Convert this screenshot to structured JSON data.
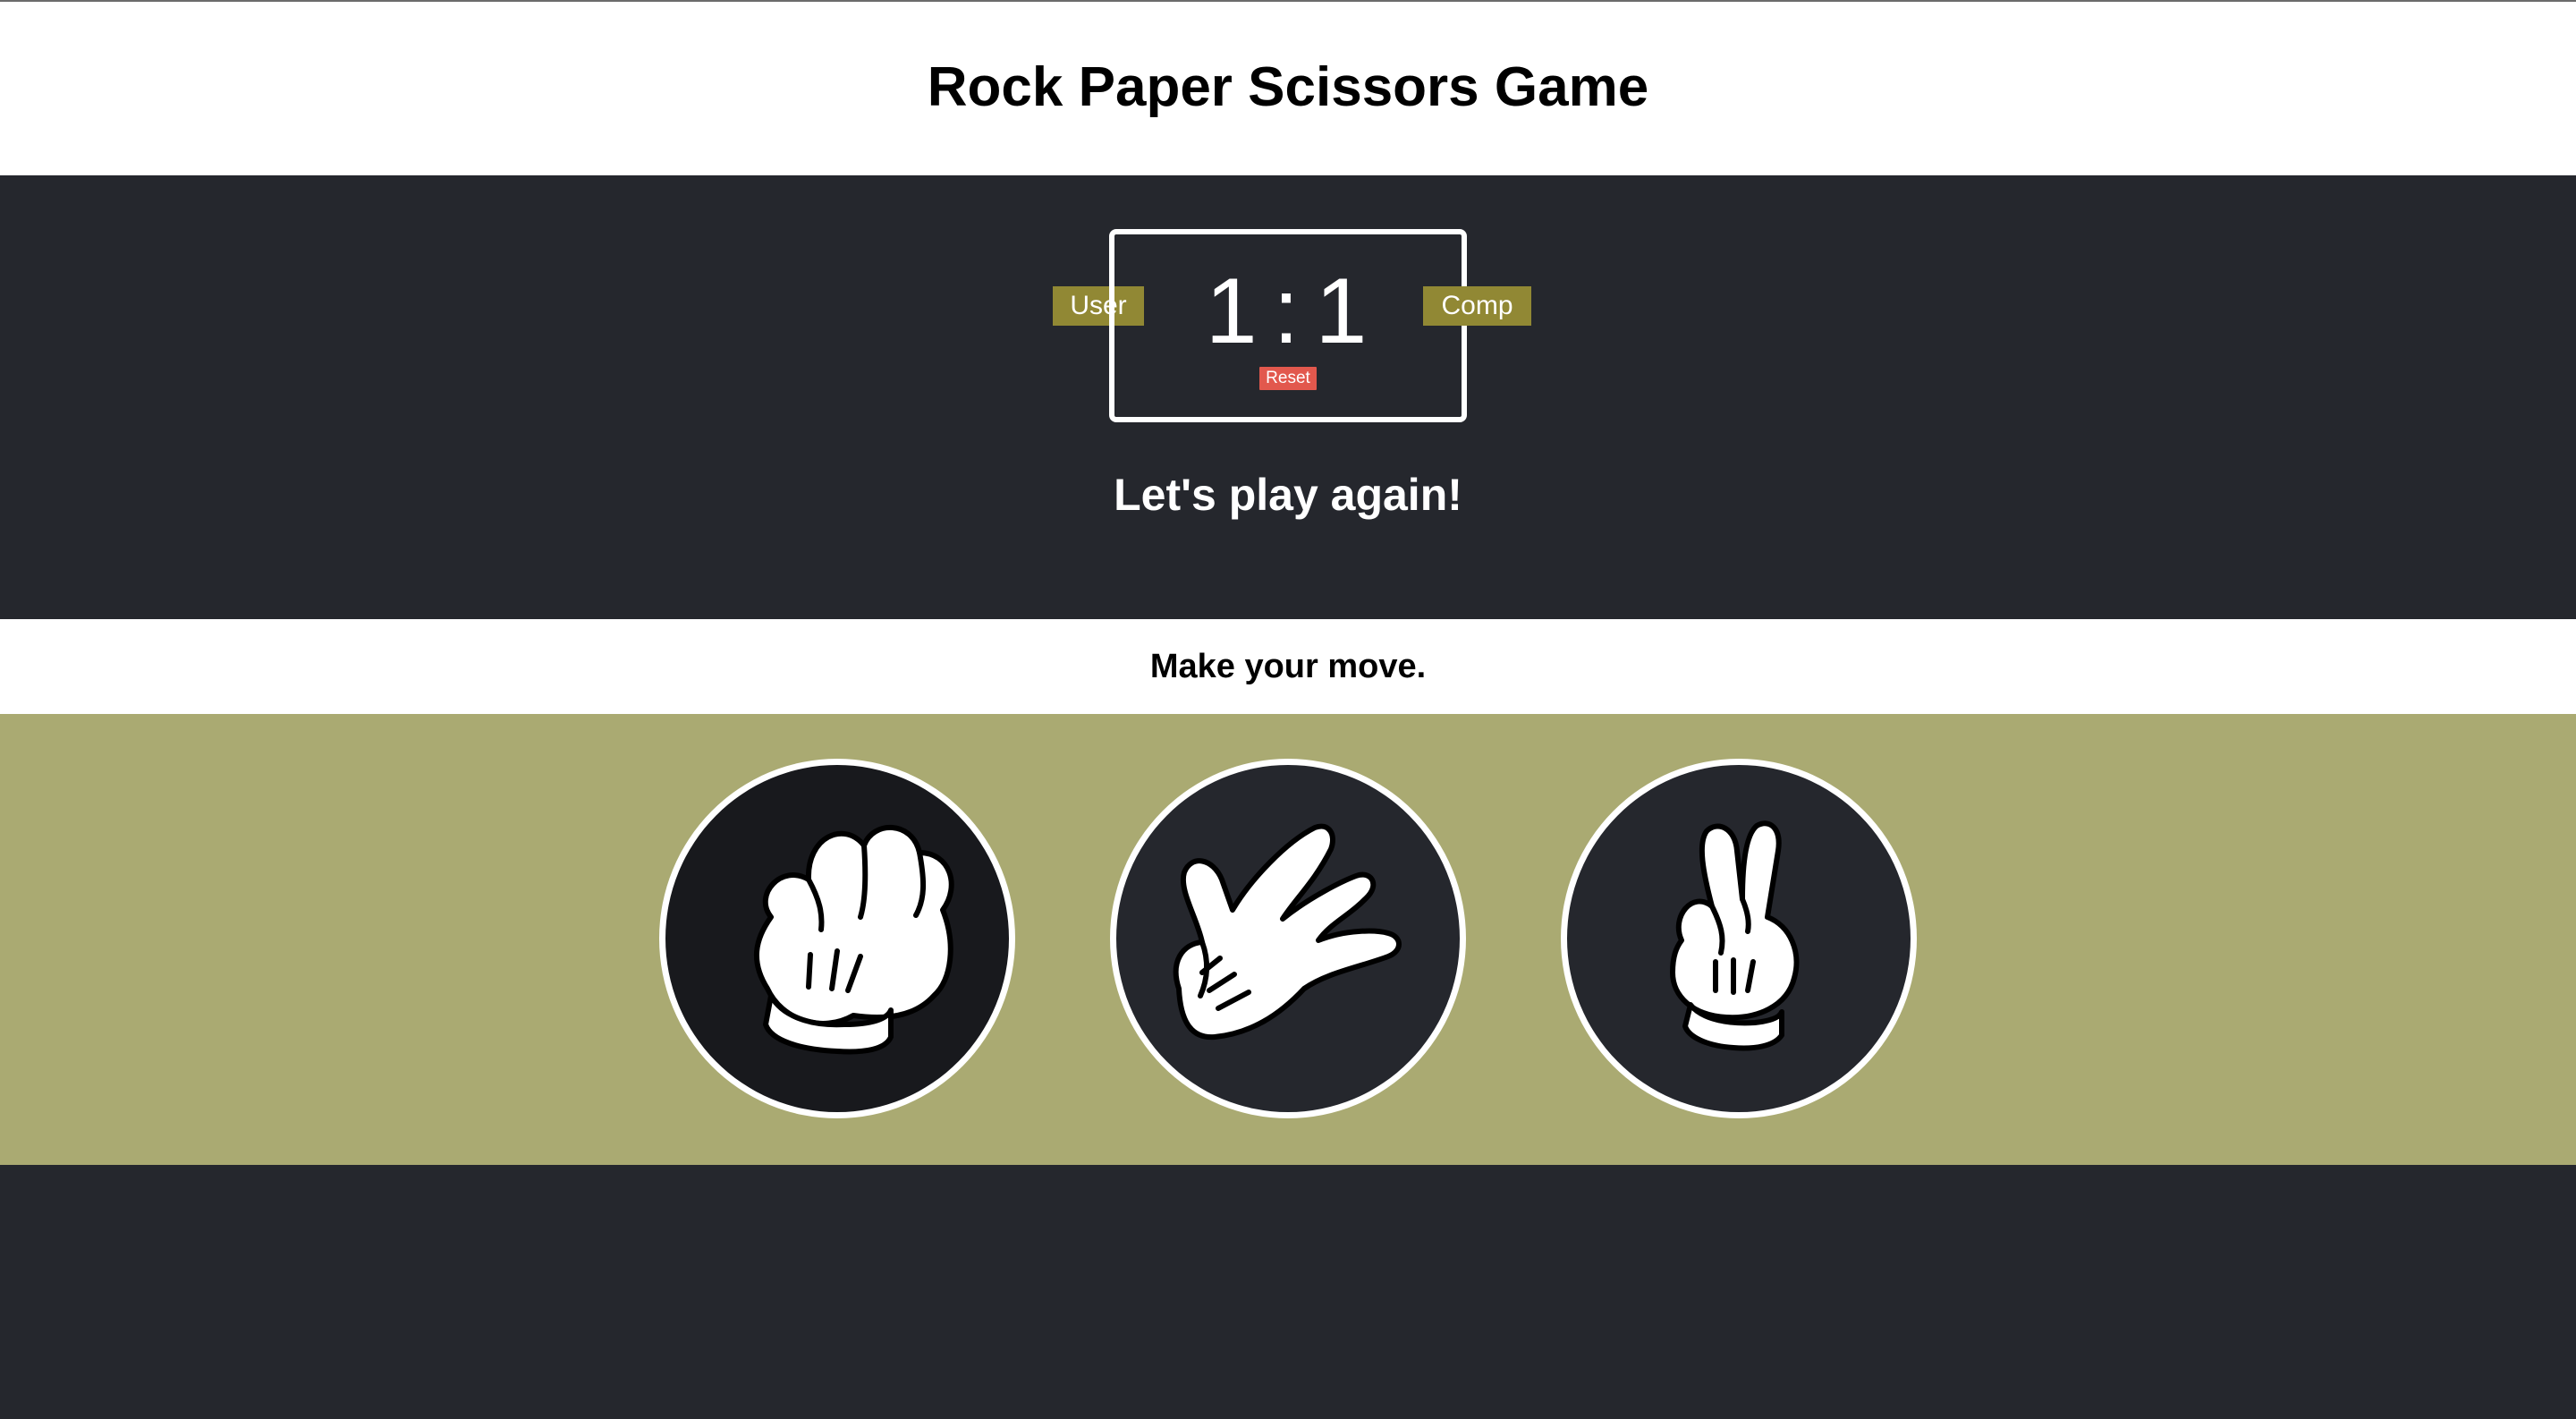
{
  "page": {
    "title": "Rock Paper Scissors Game"
  },
  "scoreboard": {
    "user_label": "User",
    "comp_label": "Comp",
    "user_score": "1",
    "separator": ":",
    "comp_score": "1",
    "reset_label": "Reset"
  },
  "result_message": "Let's play again!",
  "prompt": "Make your move.",
  "choices": [
    {
      "name": "rock",
      "icon": "rock-hand-icon"
    },
    {
      "name": "paper",
      "icon": "paper-hand-icon"
    },
    {
      "name": "scissors",
      "icon": "scissors-hand-icon"
    }
  ],
  "colors": {
    "dark_background": "#25272d",
    "badge": "#918834",
    "reset": "#e2584d",
    "choices_band": "#aaaa72"
  }
}
